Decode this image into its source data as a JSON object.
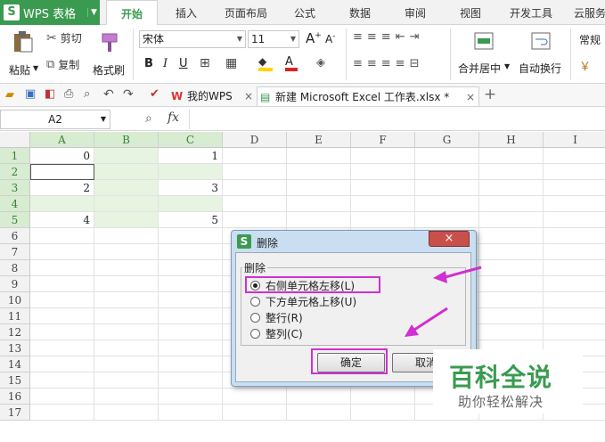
{
  "app": {
    "name": "WPS 表格",
    "logo_glyph": "S",
    "accent": "#3a9b50"
  },
  "menu_tabs": [
    "开始",
    "插入",
    "页面布局",
    "公式",
    "数据",
    "审阅",
    "视图",
    "开发工具",
    "云服务"
  ],
  "ribbon": {
    "paste": "粘贴",
    "cut": "剪切",
    "copy": "复制",
    "format_painter": "格式刷",
    "font_name": "宋体",
    "font_size": "11",
    "bold": "B",
    "italic": "I",
    "underline": "U",
    "merge_center": "合并居中",
    "wrap_text": "自动换行",
    "number_format": "常规"
  },
  "doc_tabs": [
    {
      "label": "我的WPS",
      "active": false
    },
    {
      "label": "新建 Microsoft Excel 工作表.xlsx *",
      "active": true
    }
  ],
  "formula_bar": {
    "name_box": "A2",
    "fx": "fx"
  },
  "sheet": {
    "columns": [
      "A",
      "B",
      "C",
      "D",
      "E",
      "F",
      "G",
      "H",
      "I"
    ],
    "rows": [
      "1",
      "2",
      "3",
      "4",
      "5",
      "6",
      "7",
      "8",
      "9",
      "10",
      "11",
      "12",
      "13",
      "14",
      "15",
      "16",
      "17"
    ],
    "cells": {
      "A1": "0",
      "C1": "1",
      "A3": "2",
      "C3": "3",
      "A5": "4",
      "C5": "5"
    }
  },
  "dialog": {
    "title": "删除",
    "group_label": "删除",
    "options": [
      {
        "label": "右侧单元格左移(L)",
        "selected": true
      },
      {
        "label": "下方单元格上移(U)",
        "selected": false
      },
      {
        "label": "整行(R)",
        "selected": false
      },
      {
        "label": "整列(C)",
        "selected": false
      }
    ],
    "ok": "确定",
    "cancel": "取消",
    "close": "×"
  },
  "watermark": {
    "title": "百科全说",
    "subtitle": "助你轻松解决",
    "color": "#3a9b50"
  },
  "annotation_color": "#d030d0"
}
